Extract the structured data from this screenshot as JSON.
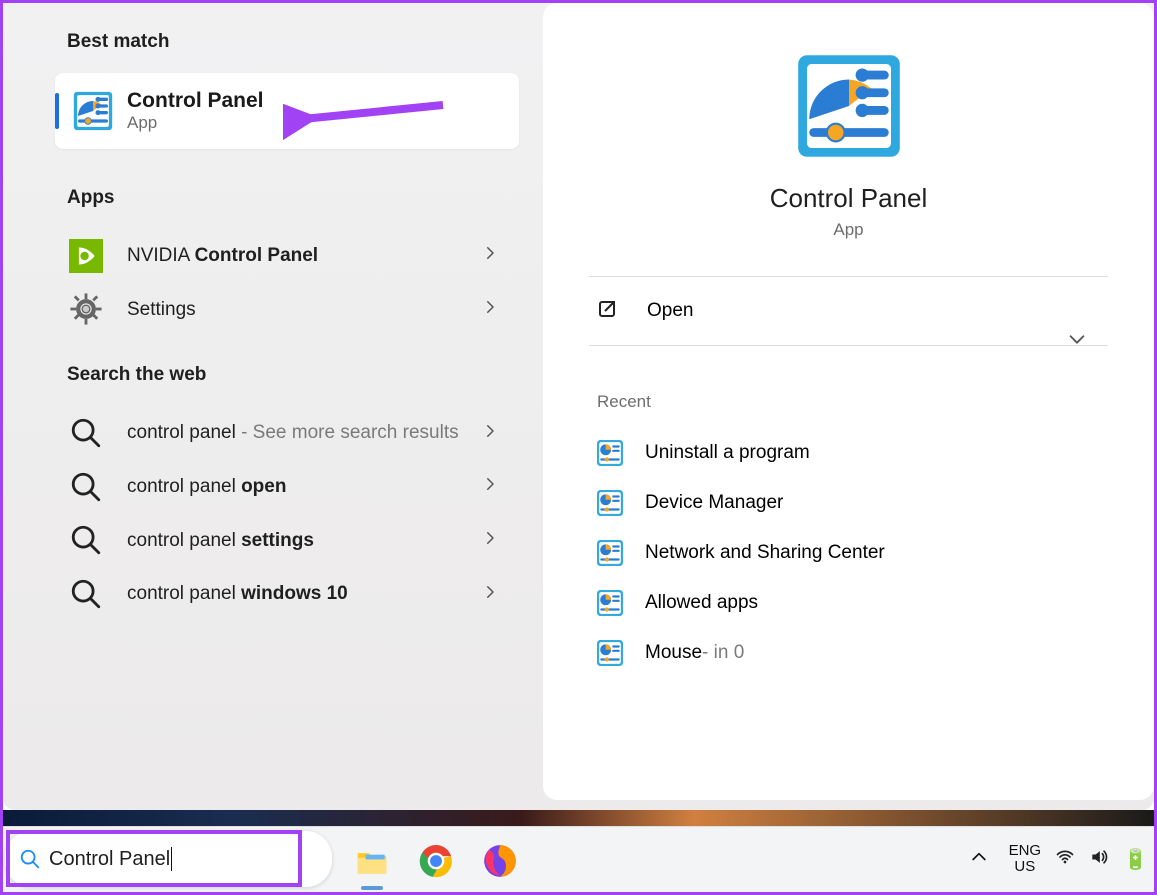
{
  "left": {
    "best_match_heading": "Best match",
    "best_match": {
      "title": "Control Panel",
      "subtitle": "App"
    },
    "apps_heading": "Apps",
    "apps": [
      {
        "prefix": "NVIDIA ",
        "bold": "Control Panel",
        "icon": "nvidia"
      },
      {
        "prefix": "Settings",
        "bold": "",
        "icon": "gear"
      }
    ],
    "web_heading": "Search the web",
    "web": [
      {
        "prefix": "control panel",
        "grey": " - See more search results"
      },
      {
        "prefix": "control panel ",
        "bold": "open"
      },
      {
        "prefix": "control panel ",
        "bold": "settings"
      },
      {
        "prefix": "control panel ",
        "bold": "windows 10"
      }
    ]
  },
  "right": {
    "title": "Control Panel",
    "subtitle": "App",
    "open_label": "Open",
    "recent_heading": "Recent",
    "recent": [
      {
        "label": "Uninstall a program",
        "suffix": ""
      },
      {
        "label": "Device Manager",
        "suffix": ""
      },
      {
        "label": "Network and Sharing Center",
        "suffix": ""
      },
      {
        "label": "Allowed apps",
        "suffix": ""
      },
      {
        "label": "Mouse",
        "suffix": " - in 0"
      }
    ]
  },
  "taskbar": {
    "query": "Control Panel",
    "lang_top": "ENG",
    "lang_bottom": "US"
  }
}
